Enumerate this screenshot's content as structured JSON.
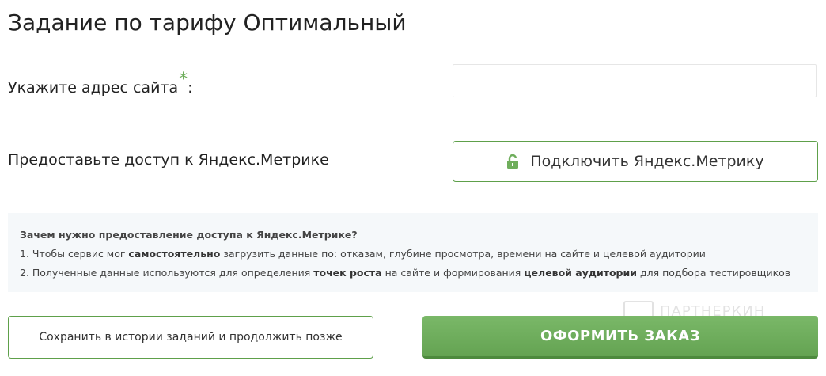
{
  "page": {
    "title": "Задание по тарифу Оптимальный"
  },
  "form": {
    "url_label": "Укажите адрес сайта",
    "required_mark": "*",
    "url_label_suffix": ":",
    "url_value": "",
    "metrika_label": "Предоставьте доступ к Яндекс.Метрике",
    "connect_button_label": "Подключить Яндекс.Метрику",
    "connect_button_icon": "lock-icon"
  },
  "info": {
    "question": "Зачем нужно предоставление доступа к Яндекс.Метрике?",
    "line1_prefix": "1. Чтобы сервис мог ",
    "line1_bold": "самостоятельно",
    "line1_suffix": " загрузить данные по: отказам, глубине просмотра, времени на сайте и целевой аудитории",
    "line2_prefix": "2. Полученные данные используются для определения ",
    "line2_bold1": "точек роста",
    "line2_middle": " на сайте и формирования ",
    "line2_bold2": "целевой аудитории",
    "line2_suffix": " для подбора тестировщиков"
  },
  "actions": {
    "save_label": "Сохранить в истории заданий и продолжить позже",
    "order_label": "ОФОРМИТЬ ЗАКАЗ"
  },
  "watermark": {
    "text": "ПАРТНЕРКИН"
  },
  "colors": {
    "accent_green": "#6fae5c",
    "button_border": "#5ea04a",
    "info_background": "#f5f8fa"
  }
}
